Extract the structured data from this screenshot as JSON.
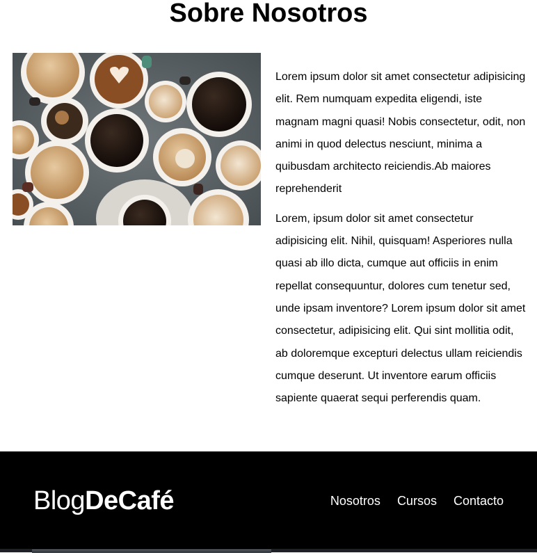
{
  "page": {
    "title": "Sobre Nosotros",
    "paragraphs": [
      "Lorem ipsum dolor sit amet consectetur adipisicing elit. Rem numquam expedita eligendi, iste magnam magni quasi! Nobis consectetur, odit, non animi in quod delectus nesciunt, minima a quibusdam architecto reiciendis.Ab maiores reprehenderit",
      "Lorem, ipsum dolor sit amet consectetur adipisicing elit. Nihil, quisquam! Asperiores nulla quasi ab illo dicta, cumque aut officiis in enim repellat consequuntur, dolores cum tenetur sed, unde ipsam inventore? Lorem ipsum dolor sit amet consectetur, adipisicing elit. Qui sint mollitia odit, ab doloremque excepturi delectus ullam reiciendis cumque deserunt. Ut inventore earum officiis sapiente quaerat sequi perferendis quam."
    ]
  },
  "footer": {
    "logo_regular": "Blog",
    "logo_bold": "DeCafé",
    "nav": [
      "Nosotros",
      "Cursos",
      "Contacto"
    ]
  },
  "colors": {
    "footer_bg": "#000000",
    "footer_text": "#ffffff",
    "table_surface": "#5d6468"
  }
}
